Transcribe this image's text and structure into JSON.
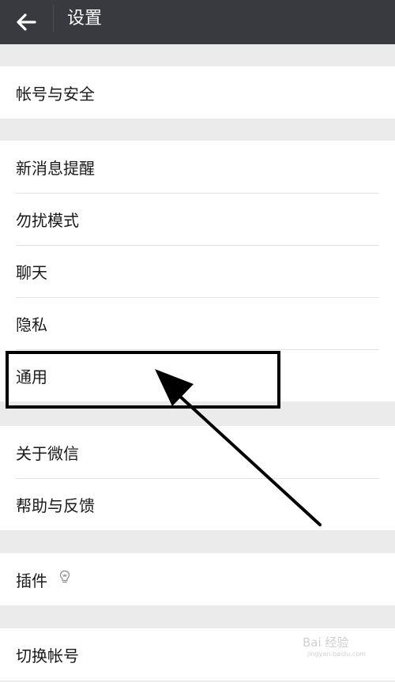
{
  "header": {
    "title": "设置",
    "back_icon": "arrow-left-icon"
  },
  "groups": [
    [
      {
        "label": "帐号与安全"
      }
    ],
    [
      {
        "label": "新消息提醒"
      },
      {
        "label": "勿扰模式"
      },
      {
        "label": "聊天"
      },
      {
        "label": "隐私"
      },
      {
        "label": "通用"
      }
    ],
    [
      {
        "label": "关于微信"
      },
      {
        "label": "帮助与反馈"
      }
    ],
    [
      {
        "label": "插件",
        "icon": "lightbulb-icon"
      }
    ],
    [
      {
        "label": "切换帐号"
      }
    ]
  ],
  "annotation": {
    "highlighted_item": "通用",
    "arrow_color": "#000000"
  },
  "watermark": {
    "text": "Bai 经验",
    "url": "jingyan.baidu.com"
  },
  "colors": {
    "header_bg": "#393a3f",
    "page_bg": "#ebebeb",
    "row_bg": "#ffffff",
    "text": "#1a1a1a",
    "divider": "#e3e3e3"
  }
}
